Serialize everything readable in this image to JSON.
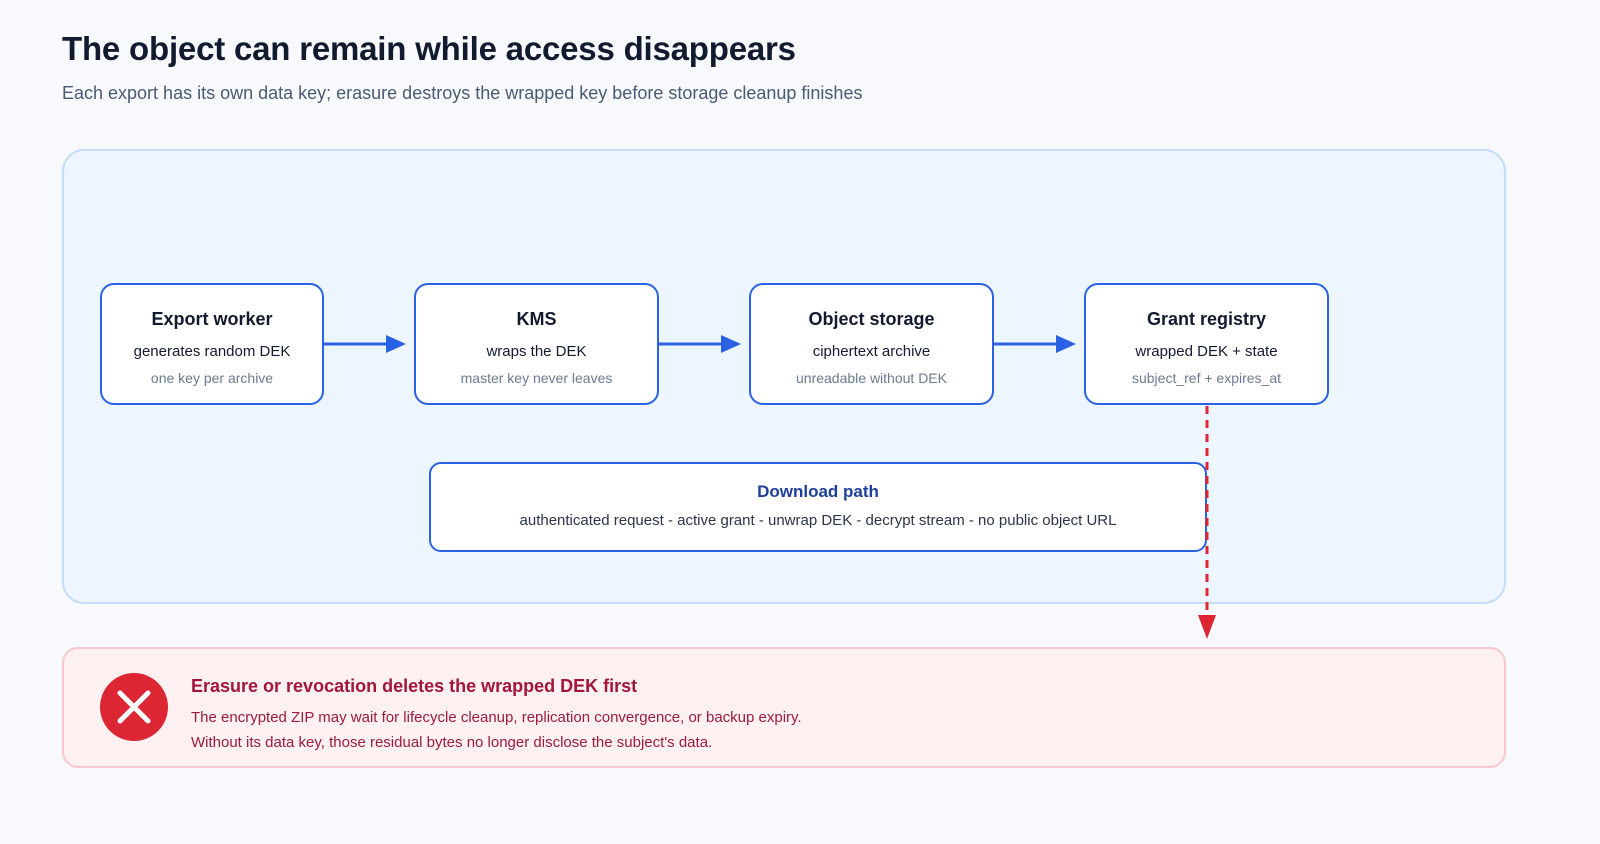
{
  "header": {
    "title": "The object can remain while access disappears",
    "subtitle": "Each export has its own data key; erasure destroys the wrapped key before storage cleanup finishes"
  },
  "flow": {
    "nodes": [
      {
        "title": "Export worker",
        "main": "generates random DEK",
        "sub": "one key per archive"
      },
      {
        "title": "KMS",
        "main": "wraps the DEK",
        "sub": "master key never leaves"
      },
      {
        "title": "Object storage",
        "main": "ciphertext archive",
        "sub": "unreadable without DEK"
      },
      {
        "title": "Grant registry",
        "main": "wrapped DEK + state",
        "sub": "subject_ref + expires_at"
      }
    ],
    "download": {
      "title": "Download path",
      "description": "authenticated request - active grant - unwrap DEK - decrypt stream - no public object URL"
    }
  },
  "alert": {
    "icon": "error-x-icon",
    "title": "Erasure or revocation deletes the wrapped DEK first",
    "line1": "The encrypted ZIP may wait for lifecycle cleanup, replication convergence, or backup expiry.",
    "line2": "Without its data key, those residual bytes no longer disclose the subject's data."
  },
  "colors": {
    "flow_arrow": "#2b62e3",
    "revoke_arrow": "#dc2633",
    "alert_icon": "#dc2633"
  }
}
